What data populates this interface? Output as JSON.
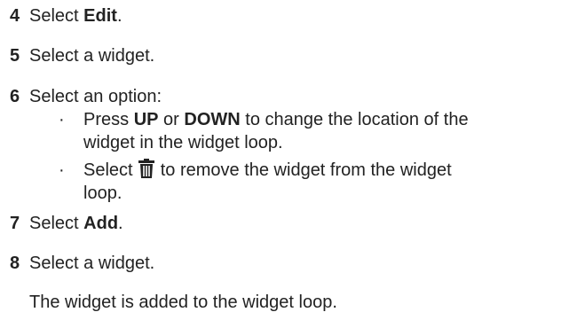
{
  "steps": [
    {
      "number": "4",
      "pre": "Select ",
      "bold": "Edit",
      "post": "."
    },
    {
      "number": "5",
      "text": "Select a widget."
    },
    {
      "number": "6",
      "text": "Select an option:"
    },
    {
      "number": "7",
      "pre": "Select ",
      "bold": "Add",
      "post": "."
    },
    {
      "number": "8",
      "text": "Select a widget."
    }
  ],
  "bullets": [
    {
      "symbol": "·",
      "parts": [
        "Press ",
        "UP",
        " or ",
        "DOWN",
        " to change the location of the"
      ],
      "cont": "widget in the widget loop."
    },
    {
      "symbol": "·",
      "pre": "Select ",
      "icon": "trash-icon",
      "post": " to remove the widget from the widget",
      "cont": "loop."
    }
  ],
  "result": "The widget is added to the widget loop."
}
